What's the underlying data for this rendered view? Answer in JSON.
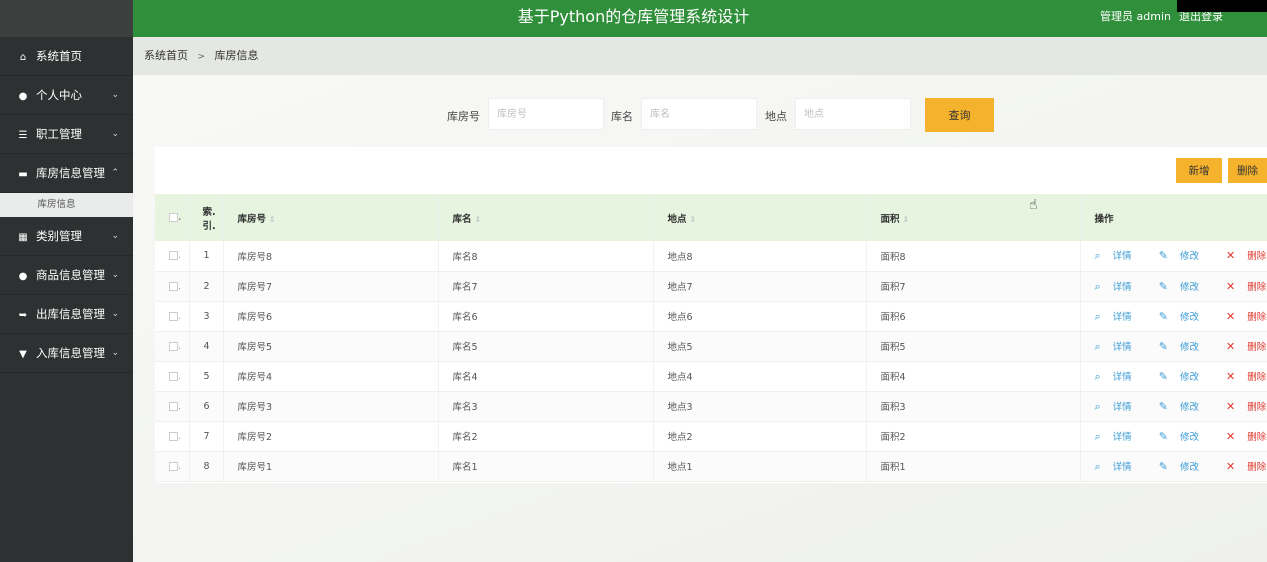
{
  "header": {
    "title": "基于Python的仓库管理系统设计",
    "user_label": "管理员 admin",
    "logout_label": "退出登录"
  },
  "sidebar": {
    "items": [
      {
        "label": "系统首页",
        "icon": "home-icon",
        "chevron": ""
      },
      {
        "label": "个人中心",
        "icon": "user-icon",
        "chevron": "⌄"
      },
      {
        "label": "职工管理",
        "icon": "list-icon",
        "chevron": "⌄"
      },
      {
        "label": "库房信息管理",
        "icon": "briefcase-icon",
        "chevron": "⌃"
      },
      {
        "label": "类别管理",
        "icon": "grid-icon",
        "chevron": "⌄"
      },
      {
        "label": "商品信息管理",
        "icon": "user-icon",
        "chevron": "⌄"
      },
      {
        "label": "出库信息管理",
        "icon": "export-icon",
        "chevron": "⌄"
      },
      {
        "label": "入库信息管理",
        "icon": "import-icon",
        "chevron": "⌄"
      }
    ],
    "active_sub": "库房信息"
  },
  "breadcrumb": {
    "home": "系统首页",
    "separator": ">",
    "current": "库房信息"
  },
  "search": {
    "fields": [
      {
        "label": "库房号",
        "placeholder": "库房号"
      },
      {
        "label": "库名",
        "placeholder": "库名"
      },
      {
        "label": "地点",
        "placeholder": "地点"
      }
    ],
    "query_label": "查询"
  },
  "toolbar": {
    "add_label": "新增",
    "delete_label": "删除"
  },
  "table": {
    "columns": [
      "索引",
      "库房号",
      "库名",
      "地点",
      "面积",
      "操作"
    ],
    "index_header_line1": "索.",
    "index_header_line2": "引.",
    "rows": [
      {
        "idx": "1",
        "no": "库房号8",
        "name": "库名8",
        "loc": "地点8",
        "area": "面积8"
      },
      {
        "idx": "2",
        "no": "库房号7",
        "name": "库名7",
        "loc": "地点7",
        "area": "面积7"
      },
      {
        "idx": "3",
        "no": "库房号6",
        "name": "库名6",
        "loc": "地点6",
        "area": "面积6"
      },
      {
        "idx": "4",
        "no": "库房号5",
        "name": "库名5",
        "loc": "地点5",
        "area": "面积5"
      },
      {
        "idx": "5",
        "no": "库房号4",
        "name": "库名4",
        "loc": "地点4",
        "area": "面积4"
      },
      {
        "idx": "6",
        "no": "库房号3",
        "name": "库名3",
        "loc": "地点3",
        "area": "面积3"
      },
      {
        "idx": "7",
        "no": "库房号2",
        "name": "库名2",
        "loc": "地点2",
        "area": "面积2"
      },
      {
        "idx": "8",
        "no": "库房号1",
        "name": "库名1",
        "loc": "地点1",
        "area": "面积1"
      }
    ],
    "ops": {
      "detail": "详情",
      "edit": "修改",
      "delete": "删除"
    }
  },
  "colors": {
    "header_green": "#2f8f3a",
    "sidebar_dark": "#2e3131",
    "accent_yellow": "#f5b22c",
    "table_header_green": "#e6f4e0",
    "link_blue": "#3a9bd6",
    "delete_red": "#e1372c"
  }
}
